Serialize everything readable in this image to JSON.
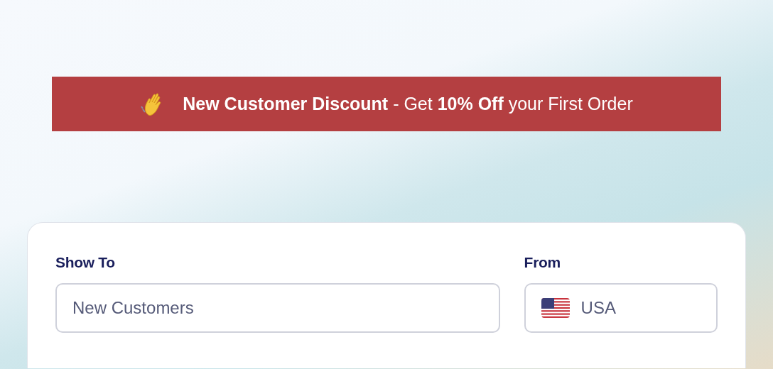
{
  "banner": {
    "text": "**New Customer Discount** - Get **10% Off** your First Order"
  },
  "form": {
    "fields": [
      {
        "kind": "text",
        "label": "Show To",
        "value": "New Customers"
      },
      {
        "kind": "country",
        "label": "From",
        "value": "USA"
      }
    ]
  }
}
